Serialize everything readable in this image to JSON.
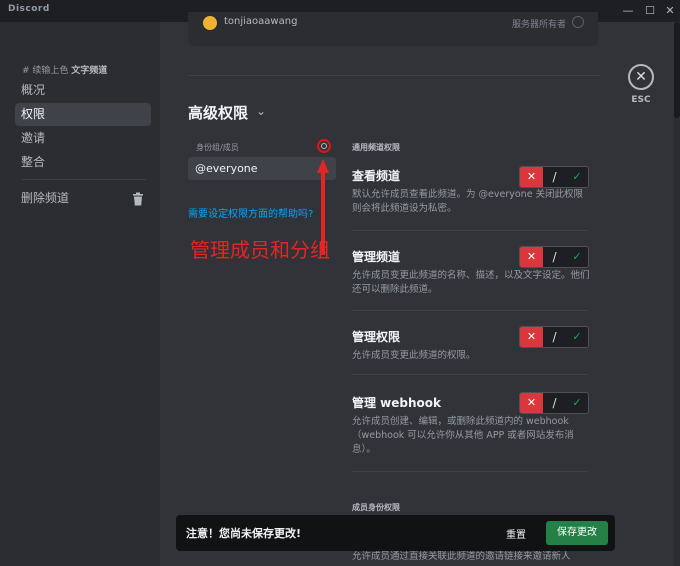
{
  "window": {
    "title": "Discord",
    "minimize": "—",
    "maximize": "☐",
    "close": "✕"
  },
  "sidebar": {
    "breadcrumb_prefix": "# 续输上色",
    "breadcrumb_section": "文字频道",
    "items": [
      {
        "label": "概况",
        "active": false
      },
      {
        "label": "权限",
        "active": true
      },
      {
        "label": "邀请",
        "active": false
      },
      {
        "label": "整合",
        "active": false
      }
    ],
    "delete_label": "删除频道"
  },
  "top_card": {
    "username": "tonjiaoaawang",
    "owner_label": "服务器所有者"
  },
  "esc": {
    "icon": "✕",
    "label": "ESC"
  },
  "advanced": {
    "title": "高级权限",
    "chevron": "⌄",
    "roles_label": "身份组/成员",
    "selected_role": "@everyone",
    "help_link": "需要设定权限方面的帮助吗?"
  },
  "annotation": {
    "text": "管理成员和分组",
    "color": "#e52525"
  },
  "permissions": {
    "general_title": "通用频道权限",
    "items": [
      {
        "name": "查看频道",
        "desc": "默认允许成员查看此频道。为 @everyone 关闭此权限则会将此频道设为私密。",
        "state": "deny"
      },
      {
        "name": "管理频道",
        "desc": "允许成员变更此频道的名称、描述，以及文字设定。他们还可以删除此频道。",
        "state": "deny"
      },
      {
        "name": "管理权限",
        "desc": "允许成员变更此频道的权限。",
        "state": "deny"
      },
      {
        "name": "管理 webhook",
        "desc": "允许成员创建、编辑，或删除此频道内的 webhook（webhook 可以允许你从其他 APP 或者网站发布消息）。",
        "state": "deny"
      }
    ],
    "member_title": "成员身份权限",
    "member_desc": "允许成员通过直接关联此频道的邀请链接来邀请新人"
  },
  "toggle_glyphs": {
    "deny": "✕",
    "neutral": "/",
    "allow": "✓"
  },
  "unsaved_bar": {
    "message": "注意！您尚未保存更改!",
    "reset": "重置",
    "save": "保存更改"
  },
  "colors": {
    "deny": "#da373c",
    "allow": "#23a55a",
    "save": "#248046",
    "link": "#00a8fc"
  }
}
